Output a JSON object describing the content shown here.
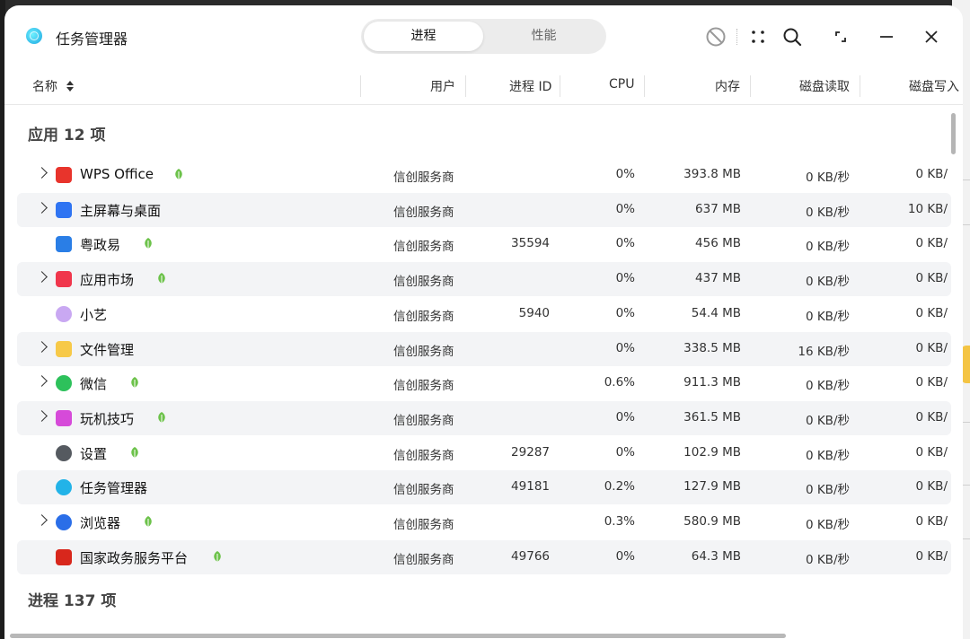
{
  "window": {
    "title": "任务管理器"
  },
  "tabs": {
    "processes": "进程",
    "performance": "性能"
  },
  "columns": {
    "name": "名称",
    "user": "用户",
    "pid": "进程 ID",
    "cpu": "CPU",
    "memory": "内存",
    "disk_read": "磁盘读取",
    "disk_write": "磁盘写入"
  },
  "sections": {
    "apps": "应用 12 项",
    "processes": "进程 137 项"
  },
  "apps": [
    {
      "name": "WPS Office",
      "user": "信创服务商",
      "pid": "",
      "cpu": "0%",
      "mem": "393.8 MB",
      "read": "0 KB/秒",
      "write": "0 KB/",
      "expandable": true,
      "eco": true,
      "icon": "wps-icon",
      "color": "#e8342c"
    },
    {
      "name": "主屏幕与桌面",
      "user": "信创服务商",
      "pid": "",
      "cpu": "0%",
      "mem": "637 MB",
      "read": "0 KB/秒",
      "write": "10 KB/",
      "expandable": true,
      "eco": false,
      "icon": "home-icon",
      "color": "#2f74f2"
    },
    {
      "name": "粤政易",
      "user": "信创服务商",
      "pid": "35594",
      "cpu": "0%",
      "mem": "456 MB",
      "read": "0 KB/秒",
      "write": "0 KB/",
      "expandable": false,
      "eco": true,
      "icon": "yuezhengyi-icon",
      "color": "#2a7ee6"
    },
    {
      "name": "应用市场",
      "user": "信创服务商",
      "pid": "",
      "cpu": "0%",
      "mem": "437 MB",
      "read": "0 KB/秒",
      "write": "0 KB/",
      "expandable": true,
      "eco": true,
      "icon": "app-market-icon",
      "color": "#f0364c"
    },
    {
      "name": "小艺",
      "user": "信创服务商",
      "pid": "5940",
      "cpu": "0%",
      "mem": "54.4 MB",
      "read": "0 KB/秒",
      "write": "0 KB/",
      "expandable": false,
      "eco": false,
      "icon": "xiaoyi-icon",
      "color": "#c9a8f2"
    },
    {
      "name": "文件管理",
      "user": "信创服务商",
      "pid": "",
      "cpu": "0%",
      "mem": "338.5 MB",
      "read": "16 KB/秒",
      "write": "0 KB/",
      "expandable": true,
      "eco": false,
      "icon": "folder-icon",
      "color": "#f7c948"
    },
    {
      "name": "微信",
      "user": "信创服务商",
      "pid": "",
      "cpu": "0.6%",
      "mem": "911.3 MB",
      "read": "0 KB/秒",
      "write": "0 KB/",
      "expandable": true,
      "eco": true,
      "icon": "wechat-icon",
      "color": "#2dc15b"
    },
    {
      "name": "玩机技巧",
      "user": "信创服务商",
      "pid": "",
      "cpu": "0%",
      "mem": "361.5 MB",
      "read": "0 KB/秒",
      "write": "0 KB/",
      "expandable": true,
      "eco": true,
      "icon": "tips-icon",
      "color": "#d64ad9"
    },
    {
      "name": "设置",
      "user": "信创服务商",
      "pid": "29287",
      "cpu": "0%",
      "mem": "102.9 MB",
      "read": "0 KB/秒",
      "write": "0 KB/",
      "expandable": false,
      "eco": true,
      "icon": "settings-gear-icon",
      "color": "#555a60"
    },
    {
      "name": "任务管理器",
      "user": "信创服务商",
      "pid": "49181",
      "cpu": "0.2%",
      "mem": "127.9 MB",
      "read": "0 KB/秒",
      "write": "0 KB/",
      "expandable": false,
      "eco": false,
      "icon": "task-manager-icon",
      "color": "#22b3e8"
    },
    {
      "name": "浏览器",
      "user": "信创服务商",
      "pid": "",
      "cpu": "0.3%",
      "mem": "580.9 MB",
      "read": "0 KB/秒",
      "write": "0 KB/",
      "expandable": true,
      "eco": true,
      "icon": "browser-icon",
      "color": "#2a6ee8"
    },
    {
      "name": "国家政务服务平台",
      "user": "信创服务商",
      "pid": "49766",
      "cpu": "0%",
      "mem": "64.3 MB",
      "read": "0 KB/秒",
      "write": "0 KB/",
      "expandable": false,
      "eco": true,
      "icon": "gov-service-icon",
      "color": "#d8271c"
    }
  ]
}
